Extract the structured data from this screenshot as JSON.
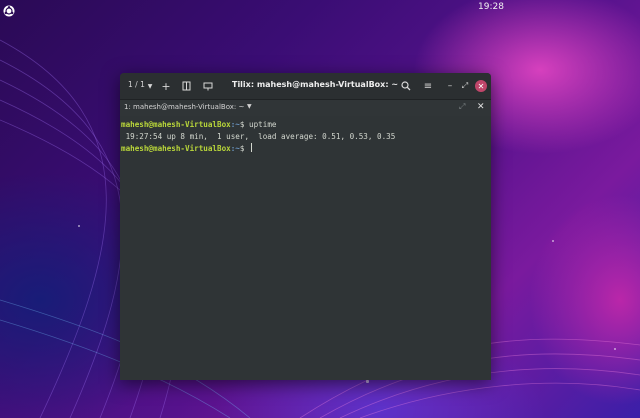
{
  "topbar": {
    "clock": "19:28",
    "activities_icon": "ubuntu-logo-icon"
  },
  "window": {
    "title": "Tilix: mahesh@mahesh-VirtualBox: ~",
    "session_counter": "1 / 1",
    "icons": {
      "session_dropdown": "chevron-down-icon",
      "add": "plus-icon",
      "split_vertical": "split-terminal-icon",
      "split_horizontal": "add-terminal-icon",
      "search": "search-icon",
      "menu": "hamburger-menu-icon",
      "minimize": "minimize-icon",
      "maximize": "maximize-icon",
      "close": "close-icon"
    },
    "accent_close": "#c0466a"
  },
  "tab": {
    "label": "1: mahesh@mahesh-VirtualBox: ~",
    "dropdown_icon": "chevron-down-icon",
    "maximize_icon": "maximize-terminal-icon",
    "close_icon": "close-icon"
  },
  "terminal": {
    "lines": [
      {
        "user": "mahesh@mahesh-VirtualBox",
        "path": ":~",
        "symbol": "$",
        "command": " uptime"
      },
      {
        "output": " 19:27:54 up 8 min,  1 user,  load average: 0.51, 0.53, 0.35"
      },
      {
        "user": "mahesh@mahesh-VirtualBox",
        "path": ":~",
        "symbol": "$",
        "command": " "
      }
    ],
    "colors": {
      "background": "#2f3436",
      "user": "#b9d63a",
      "path": "#6c98c6",
      "text": "#d3d7cf"
    }
  }
}
